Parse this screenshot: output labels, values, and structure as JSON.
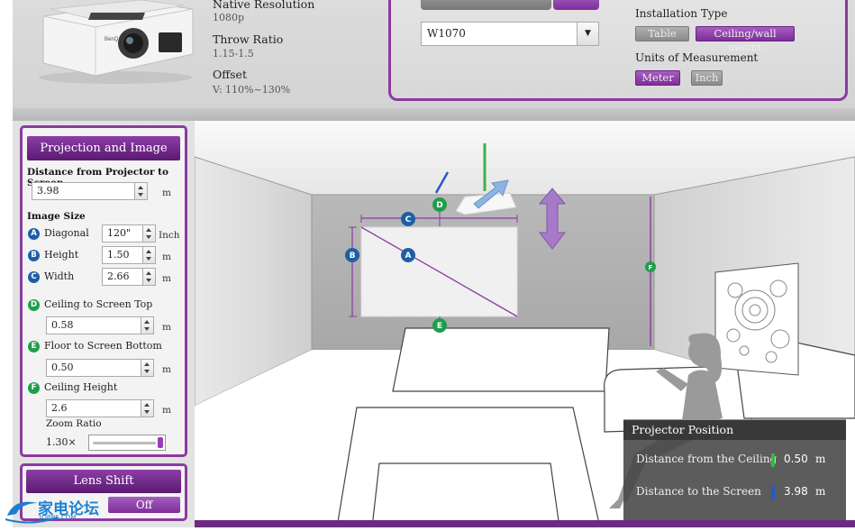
{
  "specs": {
    "native_resolution_label": "Native Resolution",
    "native_resolution_value": "1080p",
    "throw_ratio_label": "Throw Ratio",
    "throw_ratio_value": "1.15-1.5",
    "offset_label": "Offset",
    "offset_value": "V: 110%~130%"
  },
  "model": {
    "selected": "W1070",
    "installation_type_label": "Installation Type",
    "installation_options": [
      {
        "label": "Table",
        "selected": false
      },
      {
        "label": "Ceiling/wall mount",
        "selected": true
      }
    ],
    "units_label": "Units of Measurement",
    "unit_options": [
      {
        "label": "Meter",
        "selected": true
      },
      {
        "label": "Inch",
        "selected": false
      }
    ]
  },
  "projection": {
    "title": "Projection and Image",
    "distance_label": "Distance from Projector to Screen",
    "distance_value": "3.98",
    "distance_unit": "m",
    "image_size_label": "Image Size",
    "diagonal": {
      "badge": "A",
      "label": "Diagonal",
      "value": "120\"",
      "unit": "Inch"
    },
    "height": {
      "badge": "B",
      "label": "Height",
      "value": "1.50",
      "unit": "m"
    },
    "width": {
      "badge": "C",
      "label": "Width",
      "value": "2.66",
      "unit": "m"
    },
    "ceiling_to_top": {
      "badge": "D",
      "label": "Ceiling to Screen Top",
      "value": "0.58",
      "unit": "m"
    },
    "floor_to_bottom": {
      "badge": "E",
      "label": "Floor to Screen Bottom",
      "value": "0.50",
      "unit": "m"
    },
    "ceiling_height": {
      "badge": "F",
      "label": "Ceiling Height",
      "value": "2.6",
      "unit": "m"
    },
    "zoom_label": "Zoom Ratio",
    "zoom_value": "1.30×",
    "zoom_level": 1.0
  },
  "lens_shift": {
    "title": "Lens Shift",
    "toggle": "Off"
  },
  "room_markers": {
    "a": "A",
    "b": "B",
    "c": "C",
    "d": "D",
    "e": "E",
    "f": "F"
  },
  "projector_position": {
    "title": "Projector Position",
    "ceiling_label": "Distance from the Ceiling",
    "ceiling_value": "0.50",
    "ceiling_unit": "m",
    "screen_label": "Distance to the Screen",
    "screen_value": "3.98",
    "screen_unit": "m"
  },
  "colors": {
    "accent_purple": "#8b3aa0",
    "badge_blue": "#1d5fa6",
    "badge_green": "#1f9e4a",
    "indicator_green": "#3cb34a",
    "indicator_blue": "#2a58c9"
  },
  "watermark": {
    "text": "家电论坛",
    "sub": "3DBBS.COM"
  }
}
